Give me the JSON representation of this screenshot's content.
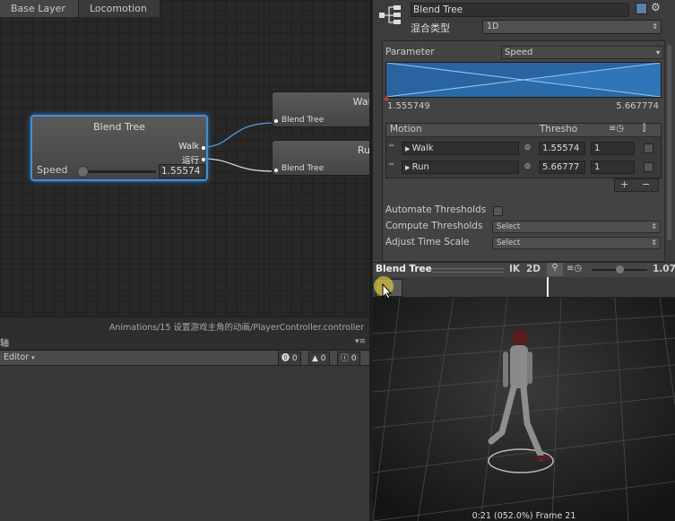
{
  "graph": {
    "breadcrumb": [
      "Base Layer",
      "Locomotion"
    ],
    "blend_tree_node": {
      "title": "Blend Tree",
      "ports": [
        "Walk",
        "运行"
      ],
      "param_label": "Speed",
      "param_value": "1.55574",
      "param_level": 0.0
    },
    "child_nodes": [
      {
        "title": "Walk",
        "subtitle": "Blend Tree"
      },
      {
        "title": "Run",
        "subtitle": "Blend Tree"
      }
    ],
    "path": "Animations/15 设置游戏主角的动画/PlayerController.controller"
  },
  "console": {
    "tab_glyph": "轴",
    "editor_dropdown": "Editor",
    "counts": {
      "errors": "0",
      "warnings": "0",
      "messages": "0"
    }
  },
  "inspector": {
    "name_value": "Blend Tree",
    "type_label": "混合类型",
    "type_value": "1D",
    "parameter_label": "Parameter",
    "parameter_value": "Speed",
    "range_min": "1.555749",
    "range_max": "5.667774",
    "table": {
      "headers": [
        "Motion",
        "Thresho"
      ],
      "rows": [
        {
          "motion": "Walk",
          "threshold": "1.55574",
          "speed": "1"
        },
        {
          "motion": "Run",
          "threshold": "5.66777",
          "speed": "1"
        }
      ],
      "add": "+",
      "remove": "−"
    },
    "automate_label": "Automate Thresholds",
    "compute_label": "Compute Thresholds",
    "compute_value": "Select",
    "adjust_label": "Adjust Time Scale",
    "adjust_value": "Select"
  },
  "preview": {
    "title": "Blend Tree",
    "ik": "IK",
    "two_d": "2D",
    "speed_value": "1.07",
    "status": "0:21 (052.0%) Frame 21"
  },
  "colors": {
    "accent": "#3f8fd8",
    "blend_fill": "#2a6aa8"
  }
}
